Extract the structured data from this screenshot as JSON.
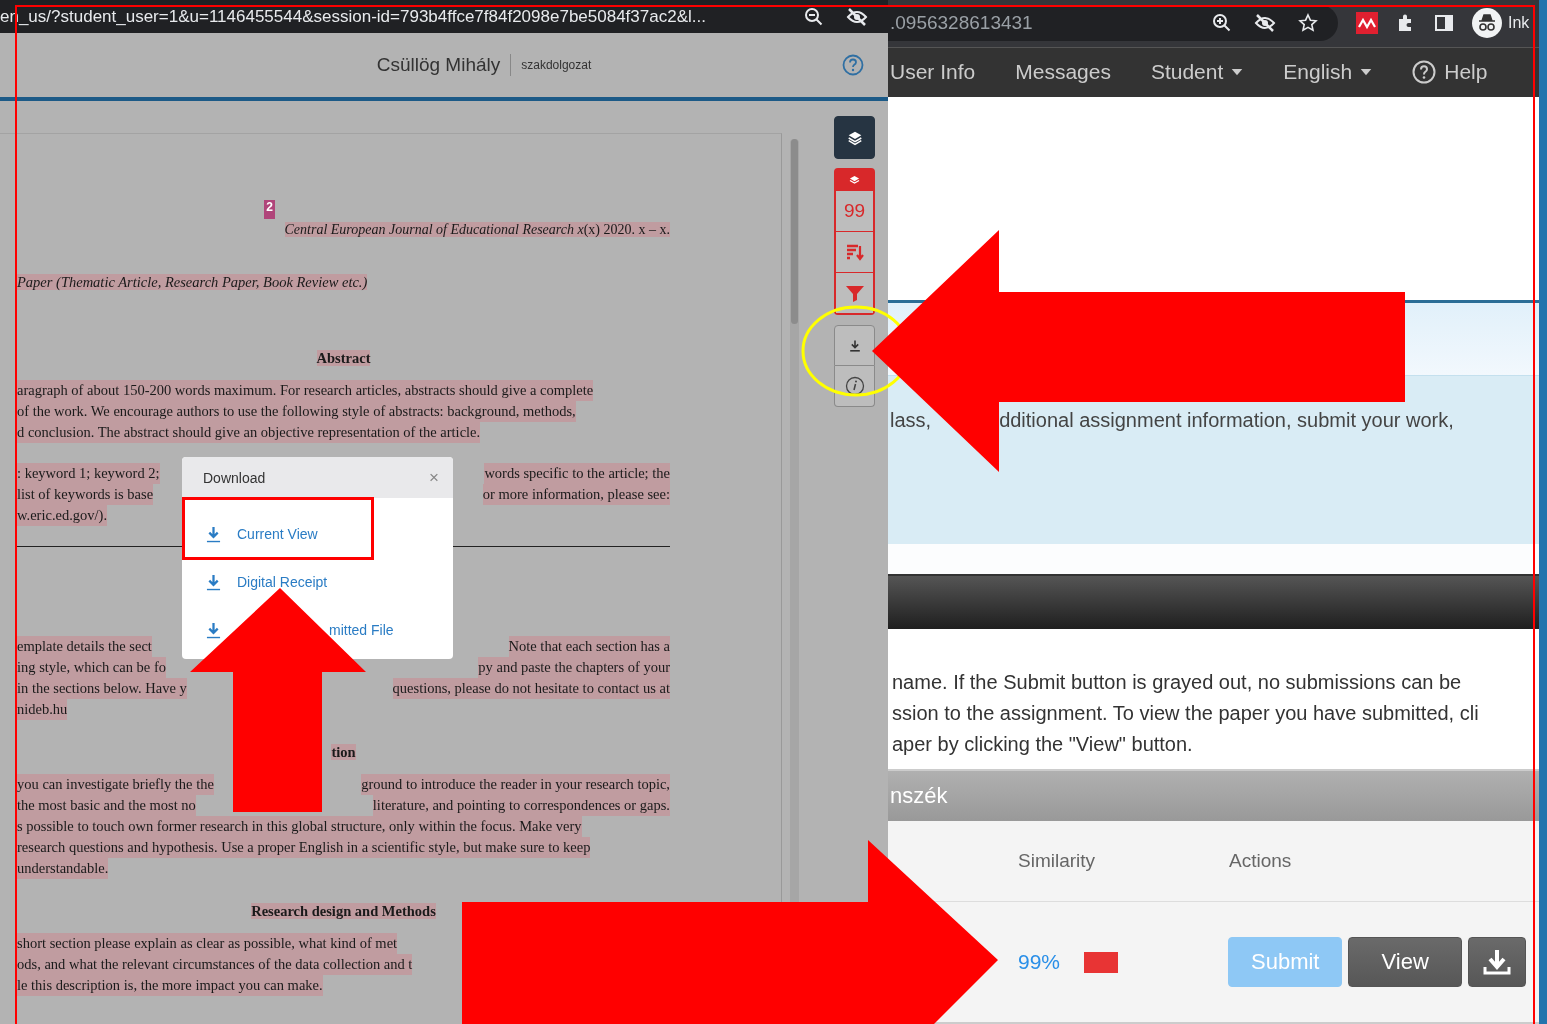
{
  "viewer": {
    "url": "en_us/?student_user=1&u=1146455544&session-id=793b4ffce7f84f2098e7be5084f37ac2&l...",
    "author": "Csüllög Mihály",
    "title": "szakdolgozat",
    "document": [
      {
        "kind": "badge",
        "text": "2"
      },
      {
        "kind": "citation",
        "text": "*Central European Journal of Educational Research x*(x) 2020. x – x."
      },
      {
        "kind": "subtitle",
        "text": "Paper (Thematic Article, Research Paper, Book Review etc.)"
      },
      {
        "kind": "heading",
        "text": "Abstract"
      },
      {
        "kind": "paragraph",
        "lines": [
          {
            "left": "aragraph of about 150-200 words maximum. For research articles, abstracts should give a complete"
          },
          {
            "left": "of the work. We encourage authors to use the following style of abstracts: background, methods,"
          },
          {
            "left": "d conclusion. The abstract should give an objective representation of the article."
          }
        ]
      },
      {
        "kind": "paragraph",
        "lines": [
          {
            "left": ": keyword 1; keyword 2;",
            "right": "words specific to the article; the"
          },
          {
            "left": "list of keywords is base",
            "right": "or more information, please see:"
          },
          {
            "left": "w.eric.ed.gov/)."
          }
        ]
      },
      {
        "kind": "rule"
      },
      {
        "kind": "paragraph",
        "lines": [
          {
            "left": "emplate details the sect",
            "right": "Note that each section has a"
          },
          {
            "left": "ing style, which can be fo",
            "right": "py and paste the chapters of your"
          },
          {
            "left": "in the sections below. Have y",
            "right": "questions, please do not hesitate to contact us at"
          },
          {
            "left": "nideb.hu"
          }
        ]
      },
      {
        "kind": "heading",
        "text": "tion"
      },
      {
        "kind": "paragraph",
        "lines": [
          {
            "left": "you can investigate briefly the the",
            "right": "ground to introduce the reader in your research topic,"
          },
          {
            "left": "the most basic and the most no",
            "right": "literature, and pointing to correspondences or gaps."
          },
          {
            "left": "s possible to touch own former research in this global structure, only within the focus. Make very"
          },
          {
            "left": "research questions and hypothesis. Use a proper English in a scientific style, but make sure to keep"
          },
          {
            "left": "understandable."
          }
        ]
      },
      {
        "kind": "heading",
        "text": "Research design and Methods"
      },
      {
        "kind": "paragraph",
        "lines": [
          {
            "left": "short section please explain as clear as possible, what kind of met"
          },
          {
            "left": "ods, and what the relevant circumstances of the data collection and t"
          },
          {
            "left": "le this description is, the more impact you can make."
          }
        ]
      }
    ],
    "similarity_score": "99",
    "download_dialog": {
      "title": "Download",
      "close": "×",
      "items": [
        {
          "label": "Current View"
        },
        {
          "label": "Digital Receipt"
        },
        {
          "label": "mitted File"
        }
      ]
    }
  },
  "browser": {
    "address": ".0956328613431",
    "profile": "Ink"
  },
  "nav": [
    {
      "label": "User Info",
      "dropdown": false
    },
    {
      "label": "Messages",
      "dropdown": false
    },
    {
      "label": "Student",
      "dropdown": true
    },
    {
      "label": "English",
      "dropdown": true
    },
    {
      "label": "Help",
      "dropdown": false,
      "kind": "help"
    }
  ],
  "info_panel": {
    "left": "lass,",
    "right": "dditional assignment information, submit your work,"
  },
  "instructions": [
    "name. If the Submit button is grayed out, no submissions can be",
    "ssion to the assignment. To view the paper you have submitted, cli",
    "aper by clicking the \"View\" button."
  ],
  "class_header": "nszék",
  "table": {
    "columns": [
      "Similarity",
      "Actions"
    ],
    "rows": [
      {
        "similarity": "99%",
        "color": "#e83434",
        "submit": {
          "label": "Submit",
          "disabled": true
        },
        "view": "View"
      }
    ]
  }
}
